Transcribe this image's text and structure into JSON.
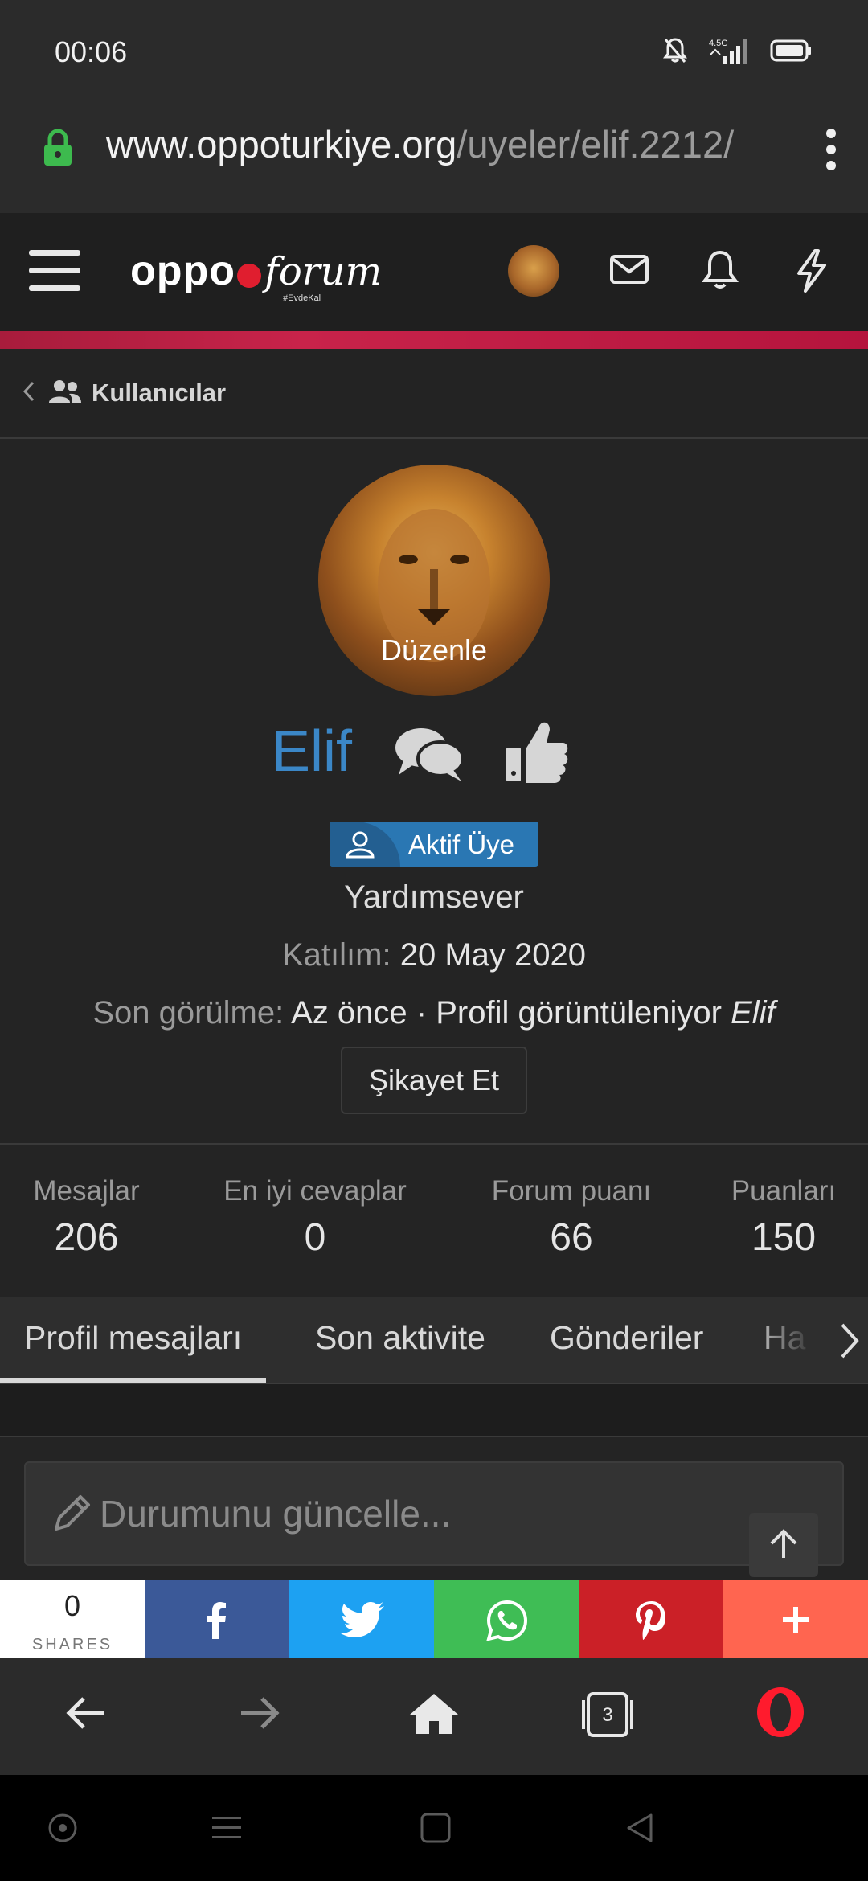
{
  "status_bar": {
    "time": "00:06",
    "network": "4.5G"
  },
  "browser": {
    "url_host": "www.oppoturkiye.org",
    "url_path": "/uyeler/elif.2212/"
  },
  "header": {
    "logo_main": "oppo",
    "logo_forum": "forum",
    "logo_tag": "#EvdeKal"
  },
  "breadcrumb": {
    "label": "Kullanıcılar"
  },
  "profile": {
    "avatar_edit": "Düzenle",
    "username": "Elif",
    "badge": "Aktif Üye",
    "user_title": "Yardımsever",
    "joined_label": "Katılım:",
    "joined_value": "20 May 2020",
    "seen_label": "Son görülme:",
    "seen_value": "Az önce · Profil görüntüleniyor",
    "seen_name": "Elif",
    "report_button": "Şikayet Et"
  },
  "stats": [
    {
      "label": "Mesajlar",
      "value": "206"
    },
    {
      "label": "En iyi cevaplar",
      "value": "0"
    },
    {
      "label": "Forum puanı",
      "value": "66"
    },
    {
      "label": "Puanları",
      "value": "150"
    }
  ],
  "tabs": [
    {
      "label": "Profil mesajları",
      "active": true
    },
    {
      "label": "Son aktivite",
      "active": false
    },
    {
      "label": "Gönderiler",
      "active": false
    },
    {
      "label": "Ha",
      "active": false
    }
  ],
  "status_update": {
    "placeholder": "Durumunu güncelle..."
  },
  "share": {
    "count": "0",
    "count_label": "SHARES",
    "buttons": [
      {
        "name": "facebook",
        "color": "#3b5998"
      },
      {
        "name": "twitter",
        "color": "#1da1f2"
      },
      {
        "name": "whatsapp",
        "color": "#25d366"
      },
      {
        "name": "pinterest",
        "color": "#cb2027"
      },
      {
        "name": "more",
        "color": "#ff6550"
      }
    ]
  },
  "browser_nav": {
    "tab_count": "3"
  },
  "colors": {
    "accent_blue": "#3b87c7",
    "header_red": "#c8234a",
    "opera_red": "#ff1b2d"
  }
}
